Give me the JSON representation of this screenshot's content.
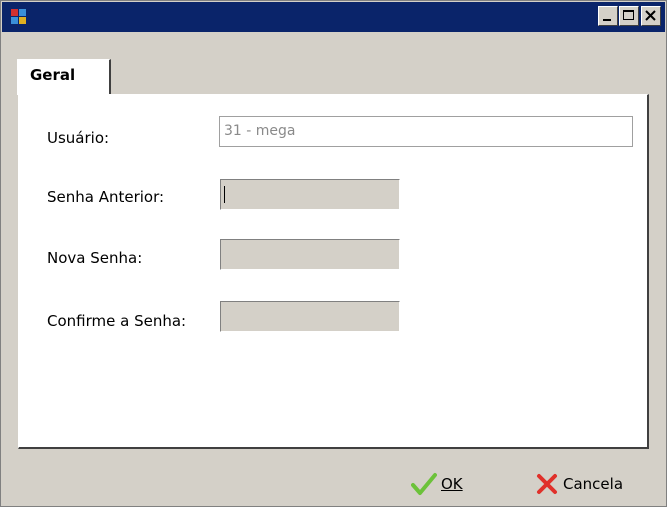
{
  "window": {
    "title": "",
    "colors": {
      "titlebar": "#0a246a",
      "face": "#d4d0c8"
    }
  },
  "tabs": [
    {
      "label": "Geral"
    }
  ],
  "form": {
    "user_label": "Usuário:",
    "user_value": "31 - mega",
    "old_password_label": "Senha Anterior:",
    "new_password_label": "Nova Senha:",
    "confirm_password_label": "Confirme a Senha:"
  },
  "buttons": {
    "ok_label": "OK",
    "cancel_label": "Cancela"
  },
  "icons": {
    "app": "app-icon",
    "minimize": "minimize-icon",
    "maximize": "maximize-icon",
    "close": "close-icon",
    "ok": "check-icon",
    "cancel": "x-icon"
  }
}
